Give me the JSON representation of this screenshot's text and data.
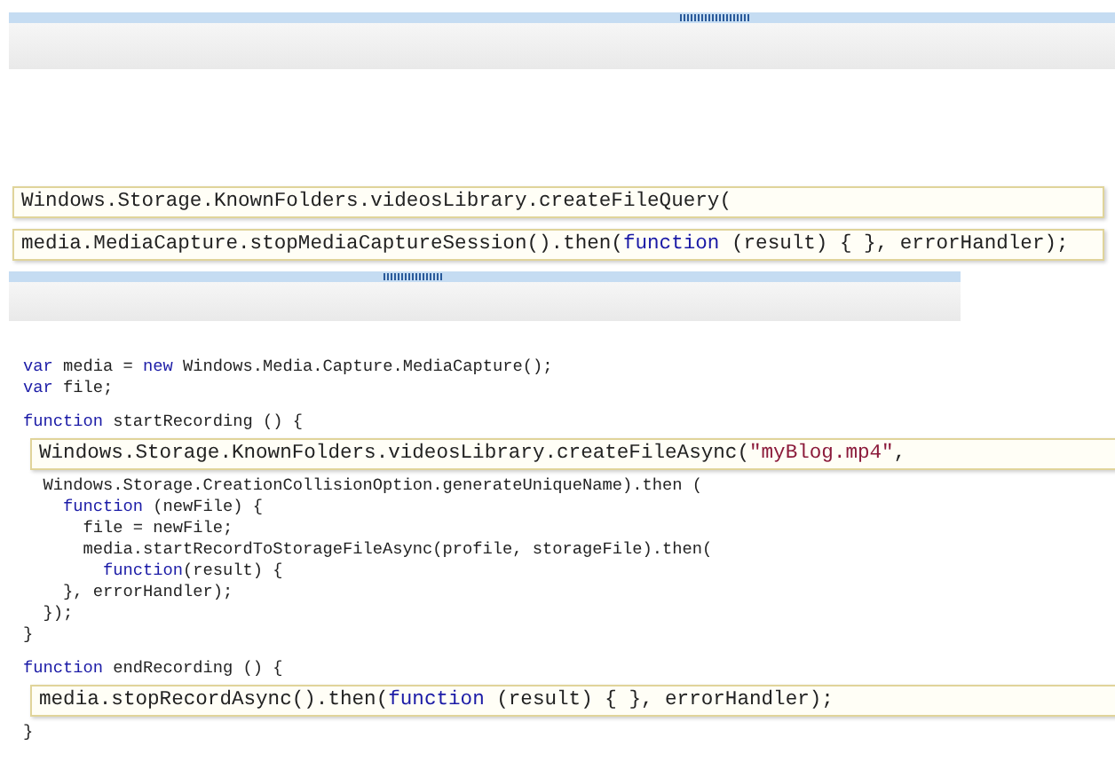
{
  "answer_pane": {
    "tiles": [
      {
        "tokens": [
          {
            "kind": "plain",
            "text": "Windows.Storage.KnownFolders.videosLibrary.createFileQuery("
          }
        ]
      },
      {
        "tokens": [
          {
            "kind": "plain",
            "text": "media.MediaCapture.stopMediaCaptureSession().then("
          },
          {
            "kind": "kw",
            "text": "function"
          },
          {
            "kind": "plain",
            "text": " (result) { }, errorHandler);"
          }
        ]
      }
    ]
  },
  "code_pane": {
    "lines": [
      {
        "kind": "code",
        "tokens": [
          {
            "kind": "kw",
            "text": "var"
          },
          {
            "kind": "plain",
            "text": " media = "
          },
          {
            "kind": "kw",
            "text": "new"
          },
          {
            "kind": "plain",
            "text": " Windows.Media.Capture.MediaCapture();"
          }
        ]
      },
      {
        "kind": "code",
        "tokens": [
          {
            "kind": "kw",
            "text": "var"
          },
          {
            "kind": "plain",
            "text": " file;"
          }
        ]
      },
      {
        "kind": "gap"
      },
      {
        "kind": "code",
        "tokens": [
          {
            "kind": "kw",
            "text": "function"
          },
          {
            "kind": "plain",
            "text": " startRecording () {"
          }
        ]
      },
      {
        "kind": "tile",
        "tokens": [
          {
            "kind": "plain",
            "text": "Windows.Storage.KnownFolders.videosLibrary.createFileAsync("
          },
          {
            "kind": "str",
            "text": "\"myBlog.mp4\""
          },
          {
            "kind": "plain",
            "text": ","
          }
        ]
      },
      {
        "kind": "code",
        "tokens": [
          {
            "kind": "plain",
            "text": "  Windows.Storage.CreationCollisionOption.generateUniqueName).then ("
          }
        ]
      },
      {
        "kind": "code",
        "tokens": [
          {
            "kind": "kw",
            "text": "    function"
          },
          {
            "kind": "plain",
            "text": " (newFile) {"
          }
        ]
      },
      {
        "kind": "code",
        "tokens": [
          {
            "kind": "plain",
            "text": "      file = newFile;"
          }
        ]
      },
      {
        "kind": "code",
        "tokens": [
          {
            "kind": "plain",
            "text": "      media.startRecordToStorageFileAsync(profile, storageFile).then("
          }
        ]
      },
      {
        "kind": "code",
        "tokens": [
          {
            "kind": "kw",
            "text": "        function"
          },
          {
            "kind": "plain",
            "text": "(result) {"
          }
        ]
      },
      {
        "kind": "code",
        "tokens": [
          {
            "kind": "plain",
            "text": "    }, errorHandler);"
          }
        ]
      },
      {
        "kind": "code",
        "tokens": [
          {
            "kind": "plain",
            "text": "  });"
          }
        ]
      },
      {
        "kind": "code",
        "tokens": [
          {
            "kind": "plain",
            "text": "}"
          }
        ]
      },
      {
        "kind": "gap"
      },
      {
        "kind": "code",
        "tokens": [
          {
            "kind": "kw",
            "text": "function"
          },
          {
            "kind": "plain",
            "text": " endRecording () {"
          }
        ]
      },
      {
        "kind": "tile",
        "tokens": [
          {
            "kind": "plain",
            "text": "media.stopRecordAsync().then("
          },
          {
            "kind": "kw",
            "text": "function"
          },
          {
            "kind": "plain",
            "text": " (result) { }, errorHandler);"
          }
        ]
      },
      {
        "kind": "code",
        "tokens": [
          {
            "kind": "plain",
            "text": "}"
          }
        ]
      }
    ]
  }
}
